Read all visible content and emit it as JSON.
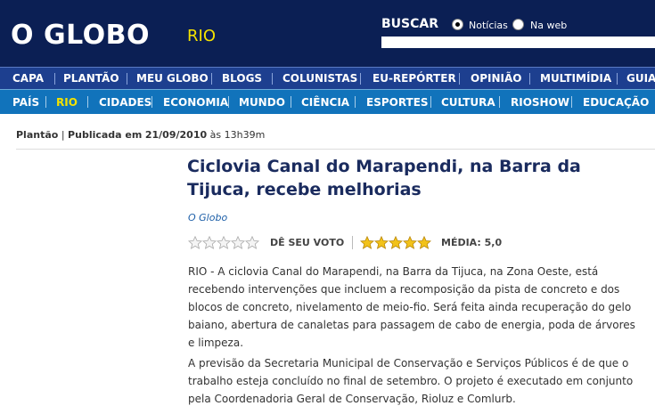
{
  "header": {
    "logo_text": "O GLOBO",
    "section": "RIO",
    "search": {
      "label": "BUSCAR",
      "options": [
        "Notícias",
        "Na web"
      ],
      "selected": "Notícias",
      "value": ""
    }
  },
  "nav_primary": [
    "CAPA",
    "PLANTÃO",
    "MEU GLOBO",
    "BLOGS",
    "COLUNISTAS",
    "EU-REPÓRTER",
    "OPINIÃO",
    "MULTIMÍDIA",
    "GUIAS"
  ],
  "nav_secondary": [
    "PAÍS",
    "RIO",
    "CIDADES",
    "ECONOMIA",
    "MUNDO",
    "CIÊNCIA",
    "ESPORTES",
    "CULTURA",
    "RIOSHOW",
    "EDUCAÇÃO"
  ],
  "nav_secondary_active": "RIO",
  "article": {
    "category": "Plantão",
    "published_label": "Publicada em",
    "date": "21/09/2010",
    "time_prefix": "às",
    "time": "13h39m",
    "title": "Ciclovia Canal do Marapendi, na Barra da Tijuca, recebe melhorias",
    "source": "O Globo",
    "rating": {
      "vote_label": "DÊ SEU VOTO",
      "average_label": "MÉDIA: 5,0",
      "user_stars": 0,
      "average_stars": 5,
      "max_stars": 5
    },
    "paragraphs": [
      "RIO - A ciclovia Canal do Marapendi, na Barra da Tijuca, na Zona Oeste, está recebendo intervenções que incluem a recomposição da pista de concreto e dos blocos de concreto, nivelamento de meio-fio. Será feita ainda recuperação do gelo baiano, abertura de canaletas para passagem de cabo de energia, poda de árvores e limpeza.",
      "A previsão da Secretaria Municipal de Conservação e Serviços Públicos é de que o trabalho esteja concluído no final de setembro. O projeto é executado em conjunto pela Coordenadoria Geral de Conservação, Rioluz e Comlurb."
    ]
  },
  "colors": {
    "header_bg": "#0b1f54",
    "nav_primary_bg": "#1d3f8f",
    "nav_secondary_bg": "#1173bb",
    "section_accent": "#f4e200",
    "title_color": "#1a2b5e",
    "star_fill": "#f2c21a"
  }
}
